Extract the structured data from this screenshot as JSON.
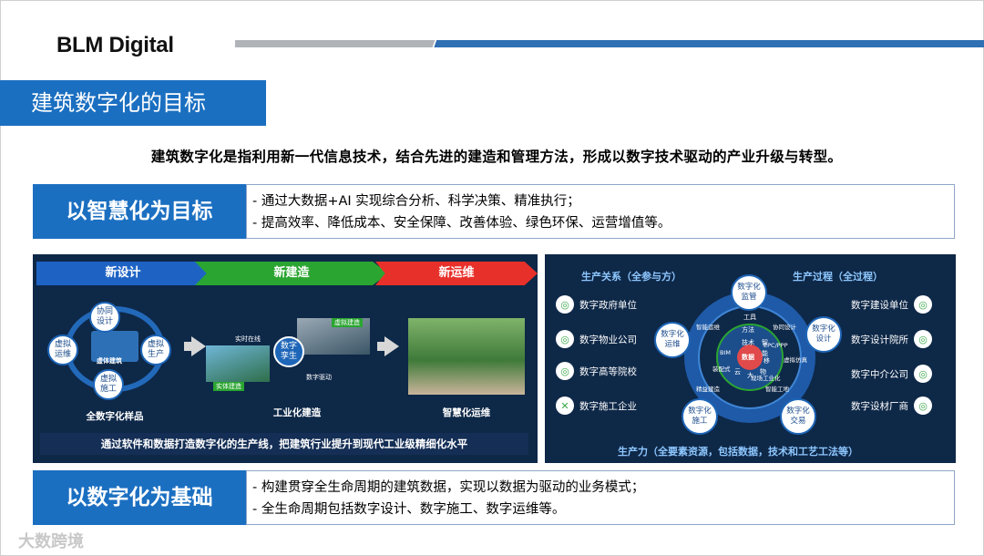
{
  "brand": {
    "logo": "BLM Digital",
    "accent": "#1b6fc1"
  },
  "page_title": "建筑数字化的目标",
  "summary": "建筑数字化是指利用新一代信息技术，结合先进的建造和管理方法，形成以数字技术驱动的产业升级与转型。",
  "goal": {
    "label": "以智慧化为目标",
    "points": [
      "- 通过大数据+AI 实现综合分析、科学决策、精准执行；",
      "- 提高效率、降低成本、安全保障、改善体验、绿色环保、运营增值等。"
    ]
  },
  "left_panel": {
    "stages": [
      "新设计",
      "新建造",
      "新运维"
    ],
    "cycle": [
      "协同\n设计",
      "虚拟\n生产",
      "虚拟\n施工",
      "虚拟\n运维"
    ],
    "cycle_center": "虚体建筑",
    "sample_label": "全数字化样品",
    "digital_twin": "数字\n孪生",
    "realtime": "实时在线",
    "virtual_build": "虚拟建造",
    "physical_build": "实体建造",
    "data_drive": "数字驱动",
    "industrial_label": "工业化建造",
    "smart_label": "智慧化运维",
    "caption": "通过软件和数据打造数字化的生产线，把建筑行业提升到现代工业级精细化水平"
  },
  "right_panel": {
    "relation_title": "生产关系（全参与方）",
    "process_title": "生产过程（全过程）",
    "force_title": "生产力（全要素资源，包括数据，技术和工艺工法等）",
    "left_items": [
      "数字政府单位",
      "数字物业公司",
      "数字高等院校",
      "数字施工企业"
    ],
    "right_items": [
      "数字建设单位",
      "数字设计院所",
      "数字中介公司",
      "数字设材厂商"
    ],
    "nodes": [
      "数字化\n监管",
      "数字化\n设计",
      "数字化\n交易",
      "数字化\n施工",
      "数字化\n运维"
    ],
    "ring_text": [
      "智能运维",
      "协同设计",
      "虚拟仿真",
      "智能工地",
      "精益建造",
      "EPC/PPP",
      "装配式",
      "现场工业化",
      "BIM"
    ],
    "core": [
      "工具",
      "方法",
      "技术",
      "数据",
      "智",
      "能",
      "云",
      "大",
      "物",
      "移"
    ]
  },
  "foundation": {
    "label": "以数字化为基础",
    "points": [
      "- 构建贯穿全生命周期的建筑数据，实现以数据为驱动的业务模式；",
      "- 全生命周期包括数字设计、数字施工、数字运维等。"
    ]
  },
  "watermark": "大数跨境"
}
